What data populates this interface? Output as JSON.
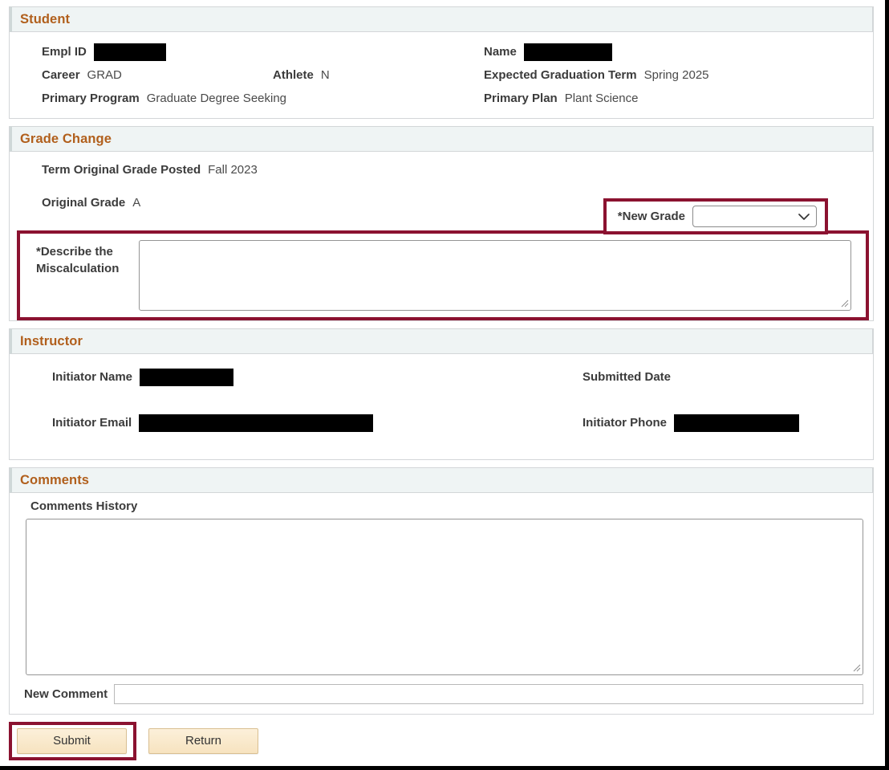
{
  "sections": {
    "student": {
      "title": "Student",
      "fields": {
        "empl_id_label": "Empl ID",
        "empl_id_value": "",
        "name_label": "Name",
        "name_value": "",
        "career_label": "Career",
        "career_value": "GRAD",
        "athlete_label": "Athlete",
        "athlete_value": "N",
        "expected_graduation_term_label": "Expected Graduation Term",
        "expected_graduation_term_value": "Spring 2025",
        "primary_program_label": "Primary Program",
        "primary_program_value": "Graduate Degree Seeking",
        "primary_plan_label": "Primary Plan",
        "primary_plan_value": "Plant Science"
      }
    },
    "grade_change": {
      "title": "Grade Change",
      "fields": {
        "term_posted_label": "Term Original Grade Posted",
        "term_posted_value": "Fall 2023",
        "original_grade_label": "Original Grade",
        "original_grade_value": "A",
        "new_grade_label": "*New Grade",
        "new_grade_value": "",
        "new_grade_options": [
          ""
        ],
        "describe_label": "*Describe the Miscalculation",
        "describe_label_line1": "*Describe the",
        "describe_label_line2": "Miscalculation",
        "describe_value": "",
        "describe_placeholder": ""
      }
    },
    "instructor": {
      "title": "Instructor",
      "fields": {
        "initiator_name_label": "Initiator Name",
        "initiator_name_value": "",
        "submitted_date_label": "Submitted Date",
        "submitted_date_value": "",
        "initiator_email_label": "Initiator Email",
        "initiator_email_value": "",
        "initiator_phone_label": "Initiator Phone",
        "initiator_phone_value": ""
      }
    },
    "comments": {
      "title": "Comments",
      "fields": {
        "comments_history_label": "Comments History",
        "comments_history_value": "",
        "new_comment_label": "New Comment",
        "new_comment_value": "",
        "new_comment_placeholder": ""
      }
    }
  },
  "buttons": {
    "submit_label": "Submit",
    "return_label": "Return"
  },
  "colors": {
    "section_title": "#b15f1c",
    "section_header_bg": "#eff4f4",
    "highlight_border": "#8b1230",
    "button_face": "#f7e3bf",
    "redaction": "#000000"
  },
  "annotations": {
    "highlighted_new_grade": true,
    "highlighted_describe": true,
    "highlighted_submit": true
  }
}
